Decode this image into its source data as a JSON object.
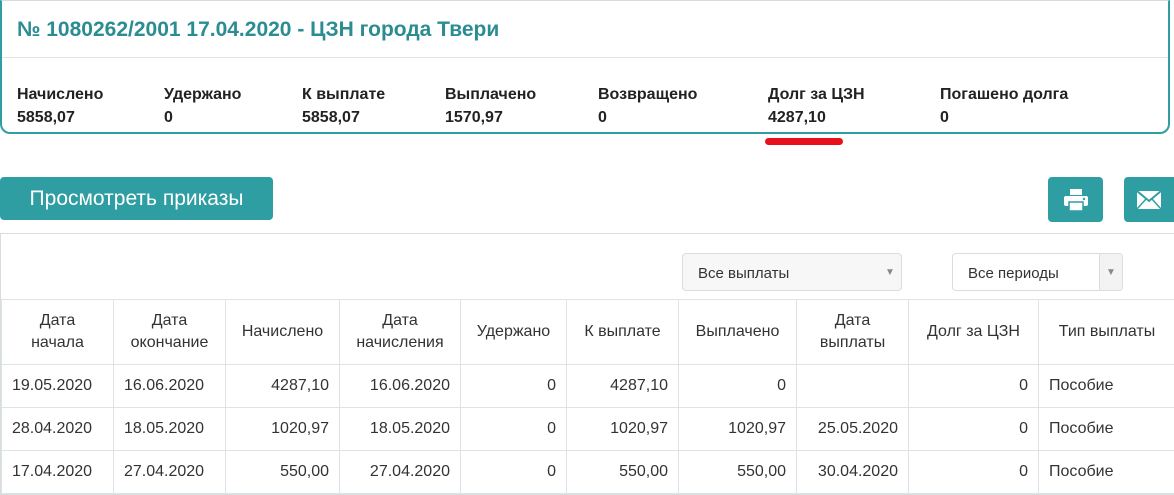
{
  "card": {
    "title": "№ 1080262/2001 17.04.2020 - ЦЗН города Твери",
    "summary": [
      {
        "label": "Начислено",
        "value": "5858,07"
      },
      {
        "label": "Удержано",
        "value": "0"
      },
      {
        "label": "К выплате",
        "value": "5858,07"
      },
      {
        "label": "Выплачено",
        "value": "1570,97"
      },
      {
        "label": "Возвращено",
        "value": "0"
      },
      {
        "label": "Долг за ЦЗН",
        "value": "4287,10"
      },
      {
        "label": "Погашено долга",
        "value": "0"
      }
    ]
  },
  "toolbar": {
    "orders_label": "Просмотреть приказы",
    "print_icon": "printer-icon",
    "mail_icon": "envelope-icon"
  },
  "filters": {
    "payments_selected": "Все выплаты",
    "periods_selected": "Все периоды"
  },
  "table": {
    "headers": [
      [
        "Дата",
        "начала"
      ],
      [
        "Дата",
        "окончание"
      ],
      [
        "Начислено"
      ],
      [
        "Дата",
        "начисления"
      ],
      [
        "Удержано"
      ],
      [
        "К выплате"
      ],
      [
        "Выплачено"
      ],
      [
        "Дата",
        "выплаты"
      ],
      [
        "Долг за ЦЗН"
      ],
      [
        "Тип выплаты"
      ]
    ],
    "rows": [
      [
        "19.05.2020",
        "16.06.2020",
        "4287,10",
        "16.06.2020",
        "0",
        "4287,10",
        "0",
        "",
        "0",
        "Пособие"
      ],
      [
        "28.04.2020",
        "18.05.2020",
        "1020,97",
        "18.05.2020",
        "0",
        "1020,97",
        "1020,97",
        "25.05.2020",
        "0",
        "Пособие"
      ],
      [
        "17.04.2020",
        "27.04.2020",
        "550,00",
        "27.04.2020",
        "0",
        "550,00",
        "550,00",
        "30.04.2020",
        "0",
        "Пособие"
      ]
    ]
  },
  "colors": {
    "accent": "#2f9ea2",
    "title": "#2b8c92",
    "highlight": "#e8111b"
  }
}
